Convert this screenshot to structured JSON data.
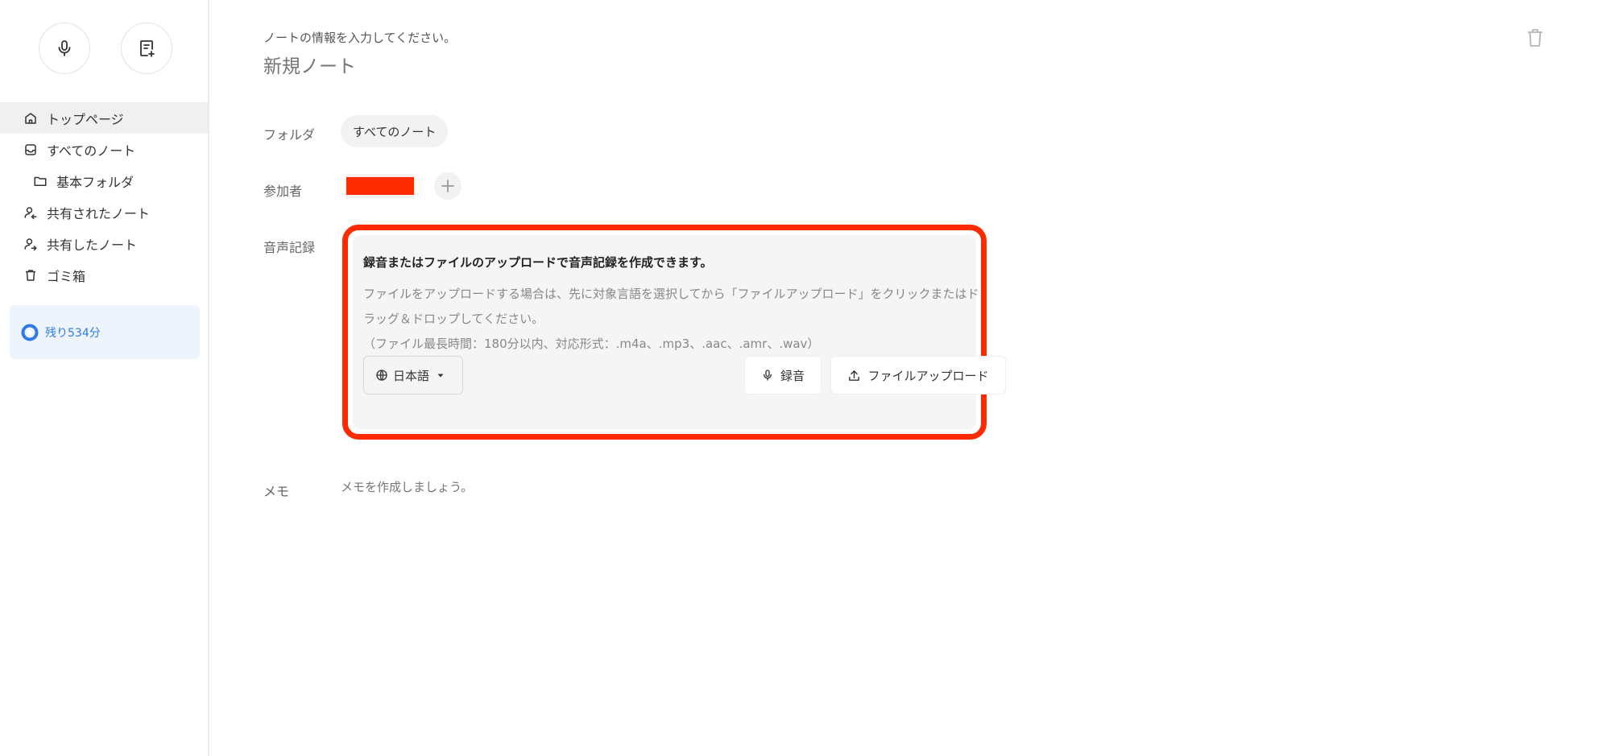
{
  "sidebar": {
    "items": [
      {
        "label": "トップページ",
        "icon": "home-icon"
      },
      {
        "label": "すべてのノート",
        "icon": "inbox-icon"
      },
      {
        "label": "基本フォルダ",
        "icon": "folder-icon"
      },
      {
        "label": "共有されたノート",
        "icon": "shared-in-icon"
      },
      {
        "label": "共有したノート",
        "icon": "shared-out-icon"
      },
      {
        "label": "ゴミ箱",
        "icon": "trash-icon"
      }
    ],
    "quota": {
      "label": "残り534分"
    }
  },
  "main": {
    "hint": "ノートの情報を入力してください。",
    "title_placeholder": "新規ノート",
    "folder": {
      "label": "フォルダ",
      "value": "すべてのノート"
    },
    "participants": {
      "label": "参加者"
    },
    "audio": {
      "label": "音声記録",
      "heading": "録音またはファイルのアップロードで音声記録を作成できます。",
      "description": "ファイルをアップロードする場合は、先に対象言語を選択してから「ファイルアップロード」をクリックまたはドラッグ＆ドロップしてください。",
      "formats": "（ファイル最長時間：180分以内、対応形式：.m4a、.mp3、.aac、.amr、.wav）",
      "language": "日本語",
      "record_label": "録音",
      "upload_label": "ファイルアップロード"
    },
    "memo": {
      "label": "メモ",
      "placeholder": "メモを作成しましょう。"
    }
  },
  "colors": {
    "accent": "#2f7be8",
    "highlight_border": "#ff2a00"
  }
}
